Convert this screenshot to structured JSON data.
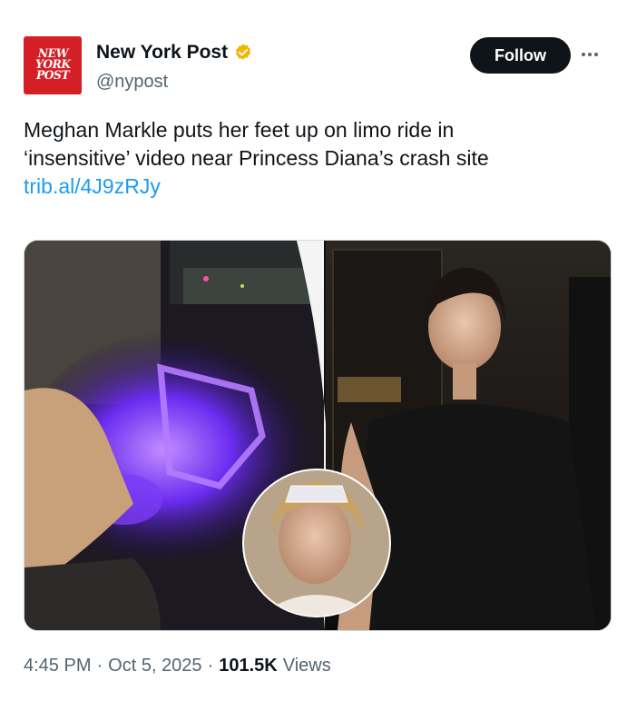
{
  "account": {
    "avatar_logo_lines": [
      "NEW",
      "YORK",
      "POST"
    ],
    "display_name": "New York Post",
    "handle": "@nypost",
    "verified_badge_icon": "verified-badge-icon",
    "verified_badge_color": "#f4b400"
  },
  "actions": {
    "follow_label": "Follow",
    "more_icon": "more-horizontal-icon"
  },
  "tweet": {
    "text_line1": "Meghan Markle puts her feet up on limo ride in",
    "text_line2": "‘insensitive’ video near Princess Diana’s crash site",
    "link": "trib.al/4J9zRJy"
  },
  "meta": {
    "time": "4:45 PM",
    "date": "Oct 5, 2025",
    "views_count": "101.5K",
    "views_label": "Views"
  },
  "colors": {
    "link": "#1d9bf0",
    "follow_bg": "#0f1419",
    "brand_red": "#d41f26",
    "limo_light": "#7b3cff"
  }
}
